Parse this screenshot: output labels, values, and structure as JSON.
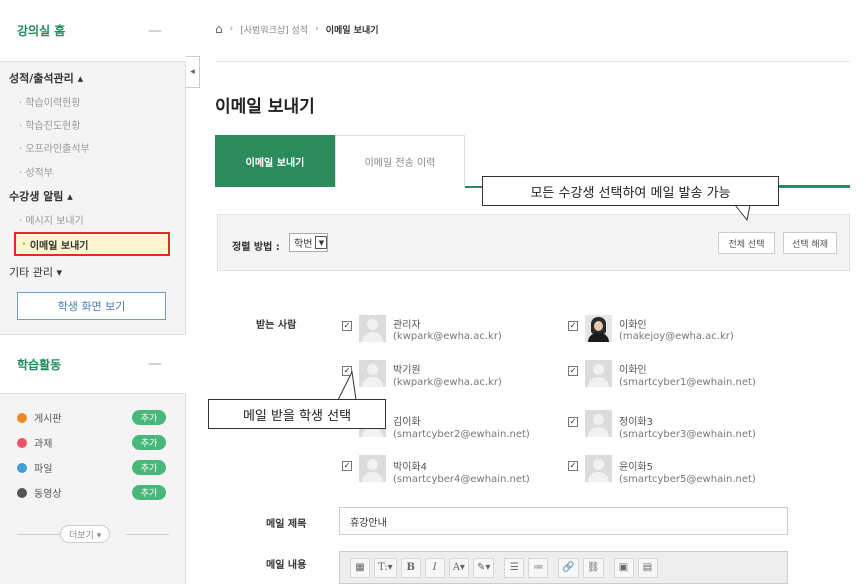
{
  "sidebar": {
    "home_title": "강의실 홈",
    "minimize_symbol": "—",
    "group_grades": "성적/출석관리 ▴",
    "grades_items": [
      "학습이력현황",
      "학습진도현황",
      "오프라인출석부",
      "성적부"
    ],
    "group_notice": "수강생 알림 ▴",
    "notice_items": [
      "메시지 보내기",
      "이메일 보내기"
    ],
    "other": "기타 관리 ▾",
    "student_view_button": "학생 화면 보기",
    "activity_title": "학습활동",
    "activities": [
      {
        "label": "게시판",
        "badge": "추가",
        "color": "#f08a24"
      },
      {
        "label": "과제",
        "badge": "추가",
        "color": "#e9546b"
      },
      {
        "label": "파일",
        "badge": "추가",
        "color": "#3fa0d8"
      },
      {
        "label": "동영상",
        "badge": "추가",
        "color": "#555555"
      }
    ],
    "more_button": "더보기 ▾"
  },
  "breadcrumb": {
    "course": "[사범워크샵] 성적",
    "current": "이메일 보내기"
  },
  "page_title": "이메일 보내기",
  "tabs": {
    "send": "이메일 보내기",
    "history": "이메일 전송 이력"
  },
  "callouts": {
    "select_all": "모든 수강생 선택하여 메일 발송 가능",
    "select_student": "메일 받을 학생 선택"
  },
  "sort": {
    "label": "정렬 방법 :",
    "value": "학번"
  },
  "buttons": {
    "select_all": "전체 선택",
    "deselect": "선택 해제"
  },
  "recipients_label": "받는 사람",
  "recipients": [
    {
      "name": "관리자",
      "email": "(kwpark@ewha.ac.kr)"
    },
    {
      "name": "이화인",
      "email": "(makejoy@ewha.ac.kr)"
    },
    {
      "name": "박기원",
      "email": "(kwpark@ewha.ac.kr)"
    },
    {
      "name": "이화인",
      "email": "(smartcyber1@ewhain.net)"
    },
    {
      "name": "김이화",
      "email": "(smartcyber2@ewhain.net)"
    },
    {
      "name": "정이화3",
      "email": "(smartcyber3@ewhain.net)"
    },
    {
      "name": "박이화4",
      "email": "(smartcyber4@ewhain.net)"
    },
    {
      "name": "윤이화5",
      "email": "(smartcyber5@ewhain.net)"
    }
  ],
  "subject": {
    "label": "메일 제목",
    "value": "휴강안내"
  },
  "body_label": "메일 내용",
  "editor_tools": [
    {
      "name": "table-icon",
      "glyph": "▦"
    },
    {
      "name": "text-format-icon",
      "glyph": "T:▾"
    },
    {
      "name": "bold-icon",
      "glyph": "B"
    },
    {
      "name": "italic-icon",
      "glyph": "I"
    },
    {
      "name": "font-color-icon",
      "glyph": "A▾"
    },
    {
      "name": "highlight-icon",
      "glyph": "✎▾"
    },
    {
      "name": "bullet-list-icon",
      "glyph": "☰"
    },
    {
      "name": "numbered-list-icon",
      "glyph": "≔"
    },
    {
      "name": "link-icon",
      "glyph": "🔗"
    },
    {
      "name": "unlink-icon",
      "glyph": "⛓"
    },
    {
      "name": "image-icon",
      "glyph": "▣"
    },
    {
      "name": "media-icon",
      "glyph": "▤"
    }
  ],
  "colors": {
    "brand_green": "#2c8b5d",
    "highlight_red": "#e12a2a"
  }
}
